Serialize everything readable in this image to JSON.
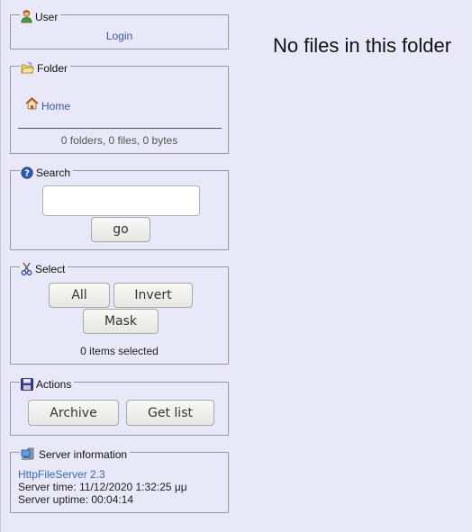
{
  "main": {
    "empty_message": "No files in this folder"
  },
  "user": {
    "title": "User",
    "login_link": "Login"
  },
  "folder": {
    "title": "Folder",
    "home_link": "Home",
    "summary": "0 folders, 0 files, 0 bytes"
  },
  "search": {
    "title": "Search",
    "input_value": "",
    "go_label": "go"
  },
  "select": {
    "title": "Select",
    "all_label": "All",
    "invert_label": "Invert",
    "mask_label": "Mask",
    "status": "0 items selected"
  },
  "actions": {
    "title": "Actions",
    "archive_label": "Archive",
    "getlist_label": "Get list"
  },
  "server": {
    "title": "Server information",
    "software_link": "HttpFileServer 2.3",
    "time": "Server time: 11/12/2020 1:32:25 μμ",
    "uptime": "Server uptime: 00:04:14"
  },
  "colors": {
    "background": "#e8e8f8",
    "link": "#3b55b3",
    "border": "#9a9a9a"
  }
}
